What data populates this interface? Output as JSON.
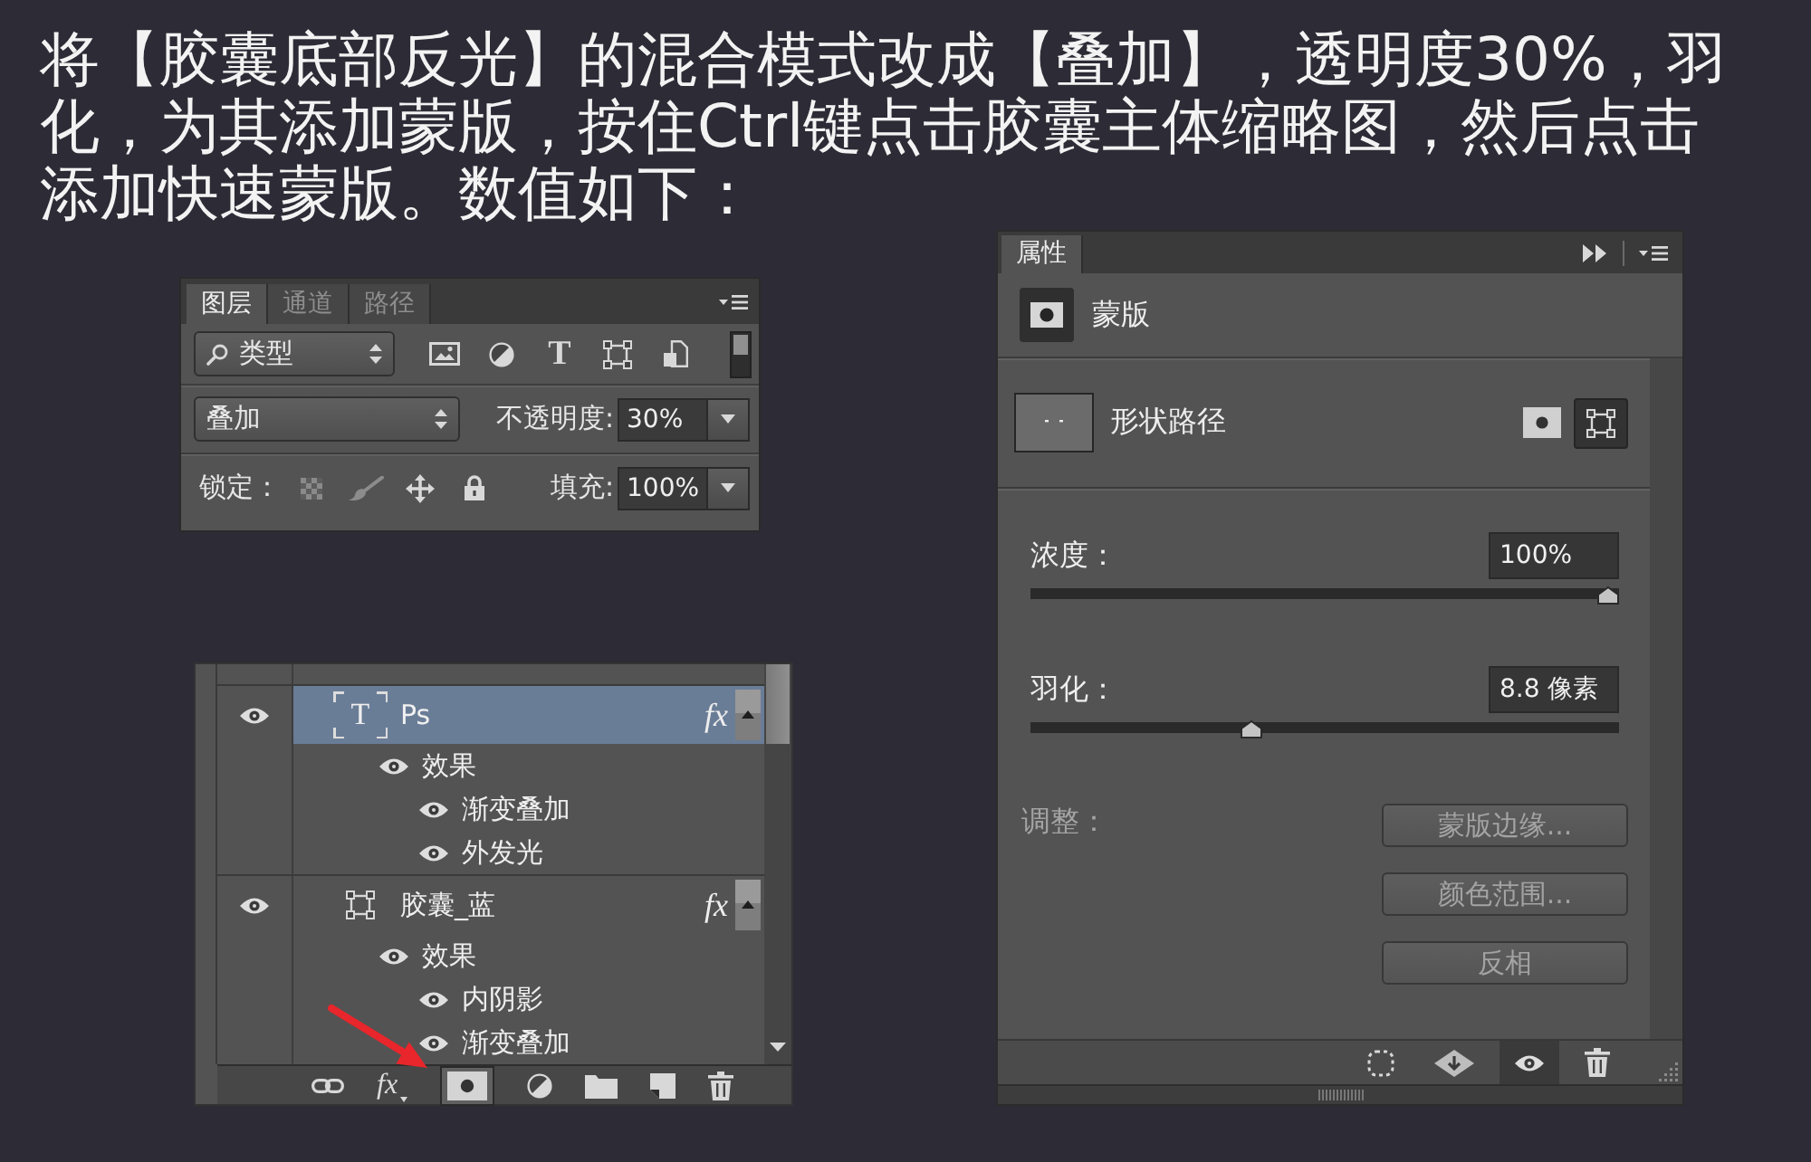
{
  "instruction": "将【胶囊底部反光】的混合模式改成【叠加】，透明度30%，羽化，为其添加蒙版，按住Ctrl键点击胶囊主体缩略图，然后点击添加快速蒙版。数值如下：",
  "layers_panel": {
    "tabs": [
      {
        "label": "图层",
        "selected": true
      },
      {
        "label": "通道",
        "selected": false
      },
      {
        "label": "路径",
        "selected": false
      }
    ],
    "filter": {
      "value": "类型"
    },
    "filter_icons": [
      {
        "kind": "image"
      },
      {
        "kind": "adjustment"
      },
      {
        "kind": "type",
        "glyph": "T"
      },
      {
        "kind": "shape"
      },
      {
        "kind": "smart"
      }
    ],
    "filter_toggle": {
      "on": true
    },
    "blend_mode": {
      "value": "叠加"
    },
    "opacity": {
      "label": "不透明度:",
      "value": "30%"
    },
    "lock": {
      "label": "锁定："
    },
    "fill": {
      "label": "填充:",
      "value": "100%"
    }
  },
  "layers_list": {
    "layers": [
      {
        "kind": "text",
        "thumb_glyph": "T",
        "name": "Ps",
        "selected": true,
        "visible": true,
        "fx": "fx",
        "effects": {
          "label": "效果",
          "visible": true,
          "items": [
            {
              "name": "渐变叠加",
              "visible": true
            },
            {
              "name": "外发光",
              "visible": true
            }
          ]
        }
      },
      {
        "kind": "shape",
        "name": "胶囊_蓝",
        "selected": false,
        "visible": true,
        "fx": "fx",
        "effects": {
          "label": "效果",
          "visible": true,
          "items": [
            {
              "name": "内阴影",
              "visible": true
            },
            {
              "name": "渐变叠加",
              "visible": true
            }
          ]
        }
      }
    ],
    "toolbar": [
      {
        "kind": "link",
        "highlighted": false
      },
      {
        "kind": "fx",
        "label": "fx",
        "highlighted": false
      },
      {
        "kind": "mask",
        "highlighted": true
      },
      {
        "kind": "adjustment",
        "highlighted": false
      },
      {
        "kind": "folder",
        "highlighted": false
      },
      {
        "kind": "new",
        "highlighted": false
      },
      {
        "kind": "trash",
        "highlighted": false
      }
    ]
  },
  "properties_panel": {
    "tabs": [
      {
        "label": "属性",
        "selected": true
      }
    ],
    "header": {
      "label": "蒙版"
    },
    "mask_row": {
      "label": "形状路径",
      "buttons": [
        {
          "kind": "pixel",
          "selected": false
        },
        {
          "kind": "vector",
          "selected": true
        }
      ]
    },
    "density": {
      "label": "浓度：",
      "value": "100%",
      "level": 1
    },
    "feather": {
      "label": "羽化：",
      "value": "8.8 像素",
      "level": 0.37
    },
    "adjust": {
      "label": "调整：",
      "disabled": true,
      "buttons": [
        "蒙版边缘...",
        "颜色范围...",
        "反相"
      ]
    },
    "toolbar": [
      {
        "kind": "selection",
        "highlighted": false
      },
      {
        "kind": "apply",
        "highlighted": false
      },
      {
        "kind": "eye",
        "highlighted": true
      },
      {
        "kind": "trash",
        "highlighted": false
      }
    ]
  }
}
